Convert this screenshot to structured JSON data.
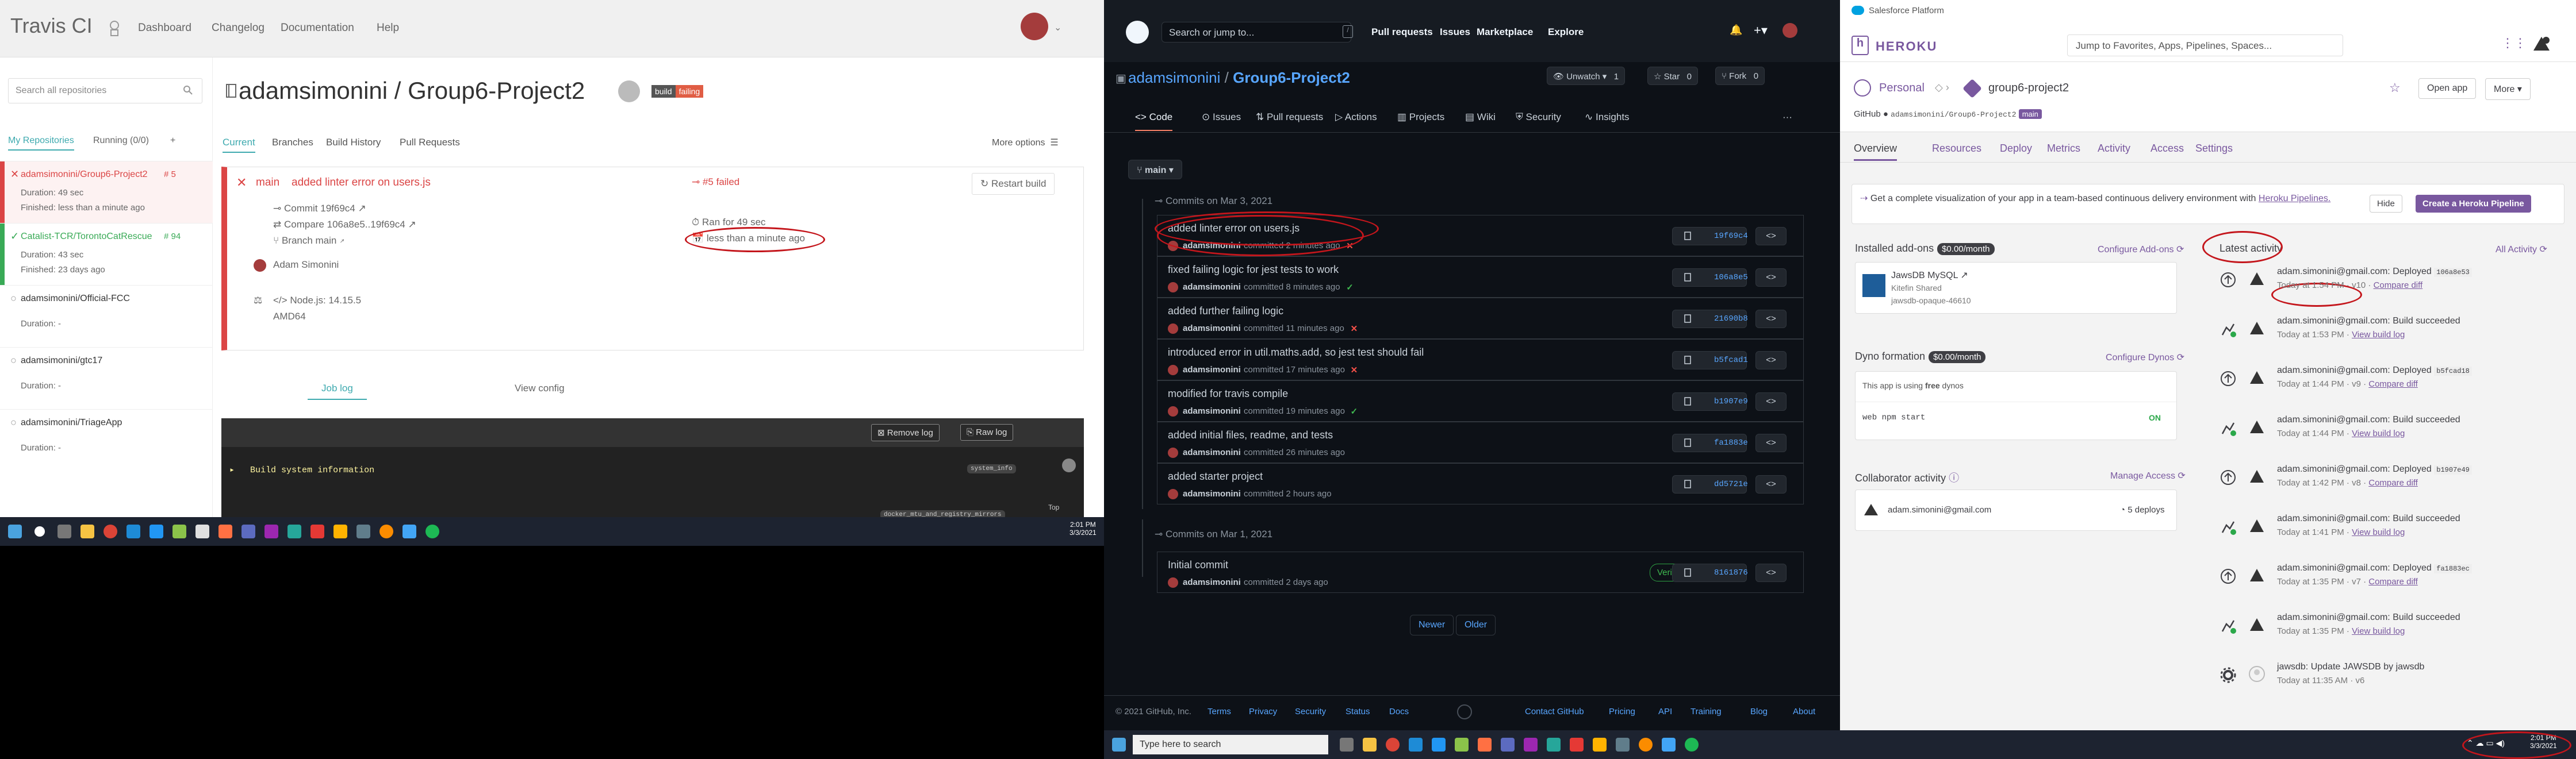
{
  "travis": {
    "logo": "Travis CI",
    "nav": [
      "Dashboard",
      "Changelog",
      "Documentation",
      "Help"
    ],
    "search_placeholder": "Search all repositories",
    "side_tabs": [
      "My Repositories",
      "Running (0/0)",
      "+"
    ],
    "repos": [
      {
        "name": "adamsimonini/Group6-Project2",
        "num": "5",
        "dur": "Duration: 49 sec",
        "fin": "Finished: less than a minute ago",
        "status": "failed"
      },
      {
        "name": "Catalist-TCR/TorontoCatRescue",
        "num": "94",
        "dur": "Duration: 43 sec",
        "fin": "Finished: 23 days ago",
        "status": "passed"
      },
      {
        "name": "adamsimonini/Official-FCC",
        "num": "",
        "dur": "Duration: -",
        "fin": "",
        "status": "none"
      },
      {
        "name": "adamsimonini/gtc17",
        "num": "",
        "dur": "Duration: -",
        "fin": "",
        "status": "none"
      },
      {
        "name": "adamsimonini/TriageApp",
        "num": "",
        "dur": "Duration: -",
        "fin": "",
        "status": "none"
      }
    ],
    "repo_title": "adamsimonini / Group6-Project2",
    "badge": [
      "build",
      "failing"
    ],
    "tabs": [
      "Current",
      "Branches",
      "Build History",
      "Pull Requests"
    ],
    "more_options": "More options",
    "build": {
      "branch": "main",
      "message": "added linter error on users.js",
      "commit": "Commit 19f69c4",
      "compare": "Compare 106a8e5..19f69c4",
      "branch_line": "Branch main",
      "author": "Adam Simonini",
      "number": "#5 failed",
      "ran": "Ran for 49 sec",
      "when": "less than a minute ago",
      "node": "Node.js: 14.15.5",
      "arch": "AMD64",
      "restart": "Restart build"
    },
    "log_tabs": [
      "Job log",
      "View config"
    ],
    "log_buttons": [
      "Remove log",
      "Raw log"
    ],
    "log_lines": [
      "Build system information"
    ],
    "log_tags": [
      "system_info",
      "docker_mtu_and_registry_mirrors"
    ],
    "log_top": "Top",
    "time": "2:01 PM",
    "date": "3/3/2021"
  },
  "github": {
    "search": "Search or jump to...",
    "nav": [
      "Pull requests",
      "Issues",
      "Marketplace",
      "Explore"
    ],
    "title_owner": "adamsimonini",
    "title_repo": "Group6-Project2",
    "buttons": {
      "unwatch": "Unwatch",
      "unwatch_n": "1",
      "star": "Star",
      "star_n": "0",
      "fork": "Fork",
      "fork_n": "0"
    },
    "tabs": [
      "Code",
      "Issues",
      "Pull requests",
      "Actions",
      "Projects",
      "Wiki",
      "Security",
      "Insights"
    ],
    "branch": "main",
    "date1": "Commits on Mar 3, 2021",
    "commits": [
      {
        "msg": "added linter error on users.js",
        "author": "adamsimonini",
        "time": "committed 2 minutes ago",
        "status": "fail",
        "sha": "19f69c4"
      },
      {
        "msg": "fixed failing logic for jest tests to work",
        "author": "adamsimonini",
        "time": "committed 8 minutes ago",
        "status": "pass",
        "sha": "106a8e5"
      },
      {
        "msg": "added further failing logic",
        "author": "adamsimonini",
        "time": "committed 11 minutes ago",
        "status": "fail",
        "sha": "21690b8"
      },
      {
        "msg": "introduced error in util.maths.add, so jest test should fail",
        "author": "adamsimonini",
        "time": "committed 17 minutes ago",
        "status": "fail",
        "sha": "b5fcad1"
      },
      {
        "msg": "modified for travis compile",
        "author": "adamsimonini",
        "time": "committed 19 minutes ago",
        "status": "pass",
        "sha": "b1907e9"
      },
      {
        "msg": "added initial files, readme, and tests",
        "author": "adamsimonini",
        "time": "committed 26 minutes ago",
        "status": "none",
        "sha": "fa1883e"
      },
      {
        "msg": "added starter project",
        "author": "adamsimonini",
        "time": "committed 2 hours ago",
        "status": "none",
        "sha": "dd5721e"
      }
    ],
    "date2": "Commits on Mar 1, 2021",
    "commit_old": {
      "msg": "Initial commit",
      "author": "adamsimonini",
      "time": "committed 2 days ago",
      "sha": "8161876",
      "verified": "Verified"
    },
    "newer": "Newer",
    "older": "Older",
    "footer": [
      "© 2021 GitHub, Inc.",
      "Terms",
      "Privacy",
      "Security",
      "Status",
      "Docs",
      "Contact GitHub",
      "Pricing",
      "API",
      "Training",
      "Blog",
      "About"
    ],
    "taskbar_search": "Type here to search"
  },
  "heroku": {
    "sf_label": "Salesforce Platform",
    "brand": "HEROKU",
    "search": "Jump to Favorites, Apps, Pipelines, Spaces...",
    "crumb_personal": "Personal",
    "app_name": "group6-project2",
    "open_app": "Open app",
    "more": "More",
    "github_label": "GitHub",
    "github_repo": "adamsimonini/Group6-Project2",
    "github_branch": "main",
    "tabs": [
      "Overview",
      "Resources",
      "Deploy",
      "Metrics",
      "Activity",
      "Access",
      "Settings"
    ],
    "banner": "Get a complete visualization of your app in a team-based continuous delivery environment with",
    "banner_link": "Heroku Pipelines.",
    "hide": "Hide",
    "create_pipeline": "Create a Heroku Pipeline",
    "addons_title": "Installed add-ons",
    "addons_cost": "$0.00/month",
    "configure_addons": "Configure Add-ons",
    "addon": {
      "name": "JawsDB MySQL",
      "plan": "Kitefin Shared",
      "id": "jawsdb-opaque-46610"
    },
    "dyno_title": "Dyno formation",
    "dyno_cost": "$0.00/month",
    "configure_dynos": "Configure Dynos",
    "dyno_note_pre": "This app is using",
    "dyno_note_free": "free",
    "dyno_note_post": "dynos",
    "dyno_cmd": "web npm start",
    "dyno_state": "ON",
    "collab_title": "Collaborator activity",
    "manage_access": "Manage Access",
    "collab": {
      "email": "adam.simonini@gmail.com",
      "deploys": "5 deploys"
    },
    "latest_title": "Latest activity",
    "all_activity": "All Activity",
    "activity": [
      {
        "who": "adam.simonini@gmail.com:",
        "what": "Deployed",
        "sha": "106a8e53",
        "when": "Today at 1:54 PM",
        "ver": "· v10 ·",
        "link": "Compare diff",
        "kind": "deploy"
      },
      {
        "who": "adam.simonini@gmail.com:",
        "what": "Build succeeded",
        "sha": "",
        "when": "Today at 1:53 PM ·",
        "ver": "",
        "link": "View build log",
        "kind": "build"
      },
      {
        "who": "adam.simonini@gmail.com:",
        "what": "Deployed",
        "sha": "b5fcad18",
        "when": "Today at 1:44 PM",
        "ver": "· v9 ·",
        "link": "Compare diff",
        "kind": "deploy"
      },
      {
        "who": "adam.simonini@gmail.com:",
        "what": "Build succeeded",
        "sha": "",
        "when": "Today at 1:44 PM ·",
        "ver": "",
        "link": "View build log",
        "kind": "build"
      },
      {
        "who": "adam.simonini@gmail.com:",
        "what": "Deployed",
        "sha": "b1907e49",
        "when": "Today at 1:42 PM",
        "ver": "· v8 ·",
        "link": "Compare diff",
        "kind": "deploy"
      },
      {
        "who": "adam.simonini@gmail.com:",
        "what": "Build succeeded",
        "sha": "",
        "when": "Today at 1:41 PM ·",
        "ver": "",
        "link": "View build log",
        "kind": "build"
      },
      {
        "who": "adam.simonini@gmail.com:",
        "what": "Deployed",
        "sha": "fa1883ec",
        "when": "Today at 1:35 PM",
        "ver": "· v7 ·",
        "link": "Compare diff",
        "kind": "deploy"
      },
      {
        "who": "adam.simonini@gmail.com:",
        "what": "Build succeeded",
        "sha": "",
        "when": "Today at 1:35 PM ·",
        "ver": "",
        "link": "View build log",
        "kind": "build"
      },
      {
        "who": "jawsdb:",
        "what": "Update JAWSDB by jawsdb",
        "sha": "",
        "when": "Today at 11:35 AM",
        "ver": "· v6",
        "link": "",
        "kind": "config"
      }
    ],
    "time": "2:01 PM",
    "date": "3/3/2021"
  }
}
